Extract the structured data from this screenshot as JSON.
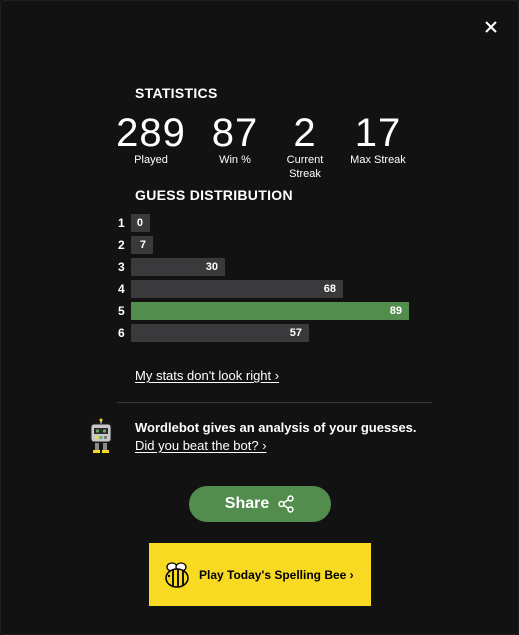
{
  "statistics": {
    "heading": "STATISTICS",
    "items": [
      {
        "value": "289",
        "label": "Played"
      },
      {
        "value": "87",
        "label": "Win %"
      },
      {
        "value": "2",
        "label": "Current Streak"
      },
      {
        "value": "17",
        "label": "Max Streak"
      }
    ]
  },
  "distribution": {
    "heading": "GUESS DISTRIBUTION",
    "rows": [
      {
        "guess": "1",
        "count": "0",
        "fraction": 0.0,
        "highlight": false
      },
      {
        "guess": "2",
        "count": "7",
        "fraction": 0.079,
        "highlight": false
      },
      {
        "guess": "3",
        "count": "30",
        "fraction": 0.337,
        "highlight": false
      },
      {
        "guess": "4",
        "count": "68",
        "fraction": 0.764,
        "highlight": false
      },
      {
        "guess": "5",
        "count": "89",
        "fraction": 1.0,
        "highlight": true
      },
      {
        "guess": "6",
        "count": "57",
        "fraction": 0.64,
        "highlight": false
      }
    ]
  },
  "links": {
    "stats_wrong": "My stats don't look right ›",
    "wordlebot_text": "Wordlebot gives an analysis of your guesses.",
    "beat_bot": "Did you beat the bot? ›"
  },
  "share": {
    "label": "Share"
  },
  "spelling_bee": {
    "label": "Play Today's Spelling Bee ›"
  },
  "icons": {
    "close": "close-icon",
    "share": "share-icon",
    "robot": "wordlebot-icon",
    "bee": "bee-icon"
  },
  "colors": {
    "background": "#121213",
    "bar": "#3a3a3c",
    "highlight": "#538d4e",
    "bee": "#f7da21"
  }
}
